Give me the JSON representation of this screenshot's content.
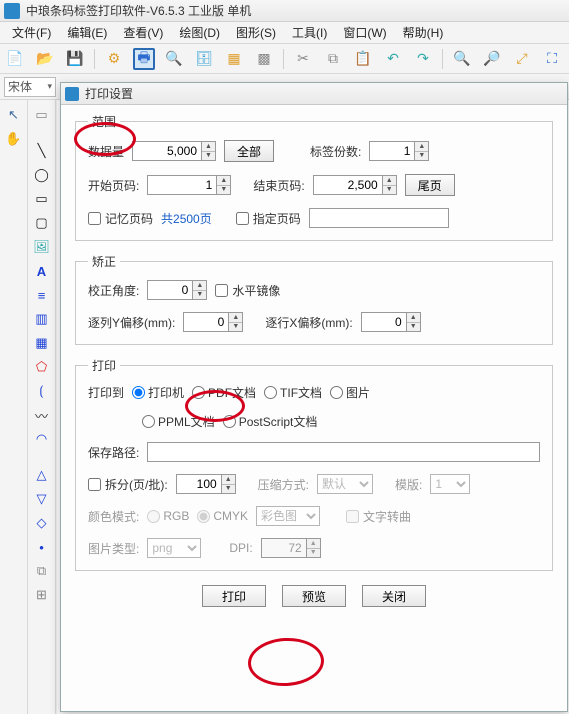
{
  "app": {
    "title": "中琅条码标签打印软件-V6.5.3 工业版 单机"
  },
  "menu": {
    "file": "文件(F)",
    "edit": "编辑(E)",
    "view": "查看(V)",
    "draw": "绘图(D)",
    "shape": "图形(S)",
    "tools": "工具(I)",
    "window": "窗口(W)",
    "help": "帮助(H)"
  },
  "font_combo": {
    "value": "宋体"
  },
  "dialog": {
    "title": "打印设置",
    "range": {
      "legend": "范围",
      "data_qty_label": "数据量",
      "data_qty": "5,000",
      "all_button": "全部",
      "copies_label": "标签份数:",
      "copies": "1",
      "start_label": "开始页码:",
      "start": "1",
      "end_label": "结束页码:",
      "end": "2,500",
      "tail_button": "尾页",
      "remember_chk": "记忆页码",
      "total_pages": "共2500页",
      "assign_chk": "指定页码",
      "assign_value": ""
    },
    "correct": {
      "legend": "矫正",
      "angle_label": "校正角度:",
      "angle": "0",
      "hflip_chk": "水平镜像",
      "col_off_label": "逐列Y偏移(mm):",
      "col_off": "0",
      "row_off_label": "逐行X偏移(mm):",
      "row_off": "0"
    },
    "print": {
      "legend": "打印",
      "to_label": "打印到",
      "r_printer": "打印机",
      "r_pdf": "PDF文档",
      "r_tif": "TIF文档",
      "r_img": "图片",
      "r_ppml": "PPML文档",
      "r_ps": "PostScript文档",
      "path_label": "保存路径:",
      "path": "",
      "split_chk": "拆分(页/批):",
      "split": "100",
      "compress_label": "压缩方式:",
      "compress": "默认",
      "template_label": "模版:",
      "template": "1",
      "color_label": "颜色模式:",
      "r_rgb": "RGB",
      "r_cmyk": "CMYK",
      "color_combo": "彩色图",
      "text_curve": "文字转曲",
      "imgtype_label": "图片类型:",
      "imgtype": "png",
      "dpi_label": "DPI:",
      "dpi": "72"
    },
    "buttons": {
      "print": "打印",
      "preview": "预览",
      "close": "关闭"
    }
  }
}
